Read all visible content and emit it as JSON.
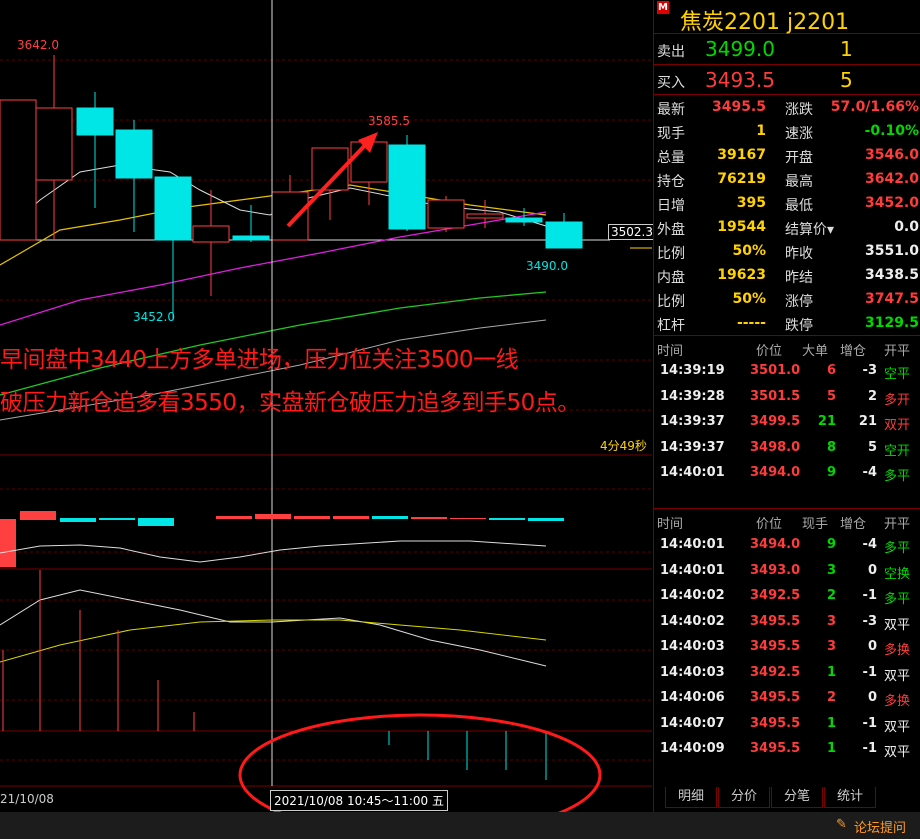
{
  "chart": {
    "high_label": "3642.0",
    "low_label": "3452.0",
    "mid_high_label": "3585.5",
    "last_low_label": "3490.0",
    "current_price_tag": "3502.3",
    "timer_label": "4分49秒",
    "date_left": "21/10/08",
    "crosshair_date": "2021/10/08 10:45～11:00 五"
  },
  "annotation": {
    "line1": "早间盘中3440上方多单进场，压力位关注3500一线",
    "line2": "破压力新仓追多看3550，实盘新仓破压力追多到手50点。"
  },
  "panel": {
    "title": "焦炭2201  j2201",
    "sell_label": "卖出",
    "sell_price": "3499.0",
    "sell_vol": "1",
    "buy_label": "买入",
    "buy_price": "3493.5",
    "buy_vol": "5",
    "stats": [
      {
        "l1": "最新",
        "v1": "3495.5",
        "c1": "red",
        "l2": "涨跌",
        "v2": "57.0/1.66%",
        "c2": "red"
      },
      {
        "l1": "现手",
        "v1": "1",
        "c1": "yellow",
        "l2": "速涨",
        "v2": "-0.10%",
        "c2": "green"
      },
      {
        "l1": "总量",
        "v1": "39167",
        "c1": "yellow",
        "l2": "开盘",
        "v2": "3546.0",
        "c2": "red"
      },
      {
        "l1": "持仓",
        "v1": "76219",
        "c1": "yellow",
        "l2": "最高",
        "v2": "3642.0",
        "c2": "red"
      },
      {
        "l1": "日增",
        "v1": "395",
        "c1": "yellow",
        "l2": "最低",
        "v2": "3452.0",
        "c2": "red"
      },
      {
        "l1": "外盘",
        "v1": "19544",
        "c1": "yellow",
        "l2": "结算价▾",
        "v2": "0.0",
        "c2": "white"
      },
      {
        "l1": "比例",
        "v1": "50%",
        "c1": "yellow",
        "l2": "昨收",
        "v2": "3551.0",
        "c2": "white"
      },
      {
        "l1": "内盘",
        "v1": "19623",
        "c1": "yellow",
        "l2": "昨结",
        "v2": "3438.5",
        "c2": "white"
      },
      {
        "l1": "比例",
        "v1": "50%",
        "c1": "yellow",
        "l2": "涨停",
        "v2": "3747.5",
        "c2": "red"
      },
      {
        "l1": "杠杆",
        "v1": "-----",
        "c1": "yellow",
        "l2": "跌停",
        "v2": "3129.5",
        "c2": "green"
      }
    ],
    "big_head": {
      "time": "时间",
      "price": "价位",
      "vol": "大单",
      "oi": "增仓",
      "type": "开平"
    },
    "big_ticks": [
      {
        "time": "14:39:19",
        "price": "3501.0",
        "vol": "6",
        "oi": "-3",
        "type": "空平",
        "pc": "red",
        "vc": "red",
        "tc": "green"
      },
      {
        "time": "14:39:28",
        "price": "3501.5",
        "vol": "5",
        "oi": "2",
        "type": "多开",
        "pc": "red",
        "vc": "red",
        "tc": "red"
      },
      {
        "time": "14:39:37",
        "price": "3499.5",
        "vol": "21",
        "oi": "21",
        "type": "双开",
        "pc": "red",
        "vc": "green",
        "tc": "red"
      },
      {
        "time": "14:39:37",
        "price": "3498.0",
        "vol": "8",
        "oi": "5",
        "type": "空开",
        "pc": "red",
        "vc": "green",
        "tc": "green"
      },
      {
        "time": "14:40:01",
        "price": "3494.0",
        "vol": "9",
        "oi": "-4",
        "type": "多平",
        "pc": "red",
        "vc": "green",
        "tc": "green"
      }
    ],
    "tick_head": {
      "time": "时间",
      "price": "价位",
      "vol": "现手",
      "oi": "增仓",
      "type": "开平"
    },
    "ticks": [
      {
        "time": "14:40:01",
        "price": "3494.0",
        "vol": "9",
        "oi": "-4",
        "type": "多平",
        "pc": "red",
        "vc": "green",
        "tc": "green"
      },
      {
        "time": "14:40:01",
        "price": "3493.0",
        "vol": "3",
        "oi": "0",
        "type": "空换",
        "pc": "red",
        "vc": "green",
        "tc": "green"
      },
      {
        "time": "14:40:02",
        "price": "3492.5",
        "vol": "2",
        "oi": "-1",
        "type": "多平",
        "pc": "red",
        "vc": "green",
        "tc": "green"
      },
      {
        "time": "14:40:02",
        "price": "3495.5",
        "vol": "3",
        "oi": "-3",
        "type": "双平",
        "pc": "red",
        "vc": "red",
        "tc": "white"
      },
      {
        "time": "14:40:03",
        "price": "3495.5",
        "vol": "3",
        "oi": "0",
        "type": "多换",
        "pc": "red",
        "vc": "red",
        "tc": "red"
      },
      {
        "time": "14:40:03",
        "price": "3492.5",
        "vol": "1",
        "oi": "-1",
        "type": "双平",
        "pc": "red",
        "vc": "green",
        "tc": "white"
      },
      {
        "time": "14:40:06",
        "price": "3495.5",
        "vol": "2",
        "oi": "0",
        "type": "多换",
        "pc": "red",
        "vc": "red",
        "tc": "red"
      },
      {
        "time": "14:40:07",
        "price": "3495.5",
        "vol": "1",
        "oi": "-1",
        "type": "双平",
        "pc": "red",
        "vc": "green",
        "tc": "white"
      },
      {
        "time": "14:40:09",
        "price": "3495.5",
        "vol": "1",
        "oi": "-1",
        "type": "双平",
        "pc": "red",
        "vc": "green",
        "tc": "white"
      }
    ],
    "tabs": [
      "明细",
      "分价",
      "分笔",
      "统计"
    ]
  },
  "footer": {
    "forum_link": "论坛提问"
  },
  "colors": {
    "up": "#ff3b3b",
    "down": "#00e5e5",
    "highlight": "#ff1a1a",
    "accent": "#ffd200"
  }
}
